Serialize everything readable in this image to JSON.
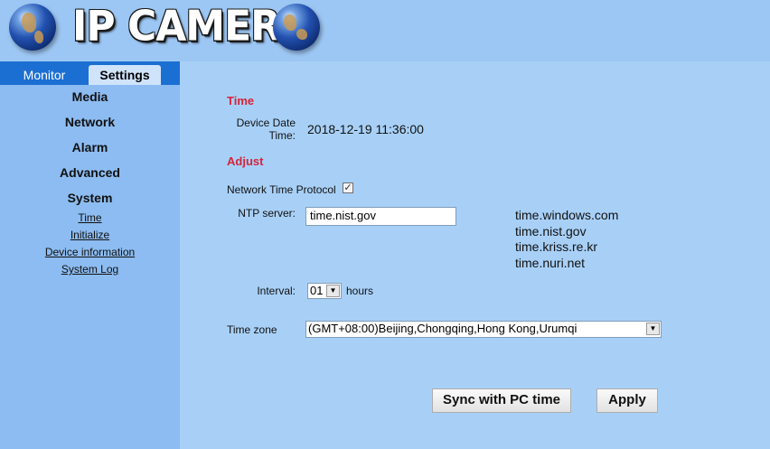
{
  "header": {
    "title": "IP CAMERA",
    "icons": [
      "globe-icon",
      "globe-icon"
    ]
  },
  "sidebar": {
    "tabs": [
      {
        "label": "Monitor",
        "active": false
      },
      {
        "label": "Settings",
        "active": true
      }
    ],
    "menu": [
      "Media",
      "Network",
      "Alarm",
      "Advanced",
      "System"
    ],
    "system_submenu": [
      "Time",
      "Initialize",
      "Device information",
      "System Log"
    ]
  },
  "time": {
    "section_title": "Time",
    "device_date_label_line1": "Device Date",
    "device_date_label_line2": "Time:",
    "device_date_value": "2018-12-19 11:36:00"
  },
  "adjust": {
    "section_title": "Adjust",
    "ntp_protocol_label": "Network Time Protocol",
    "ntp_protocol_checked": "✓",
    "ntp_server_label": "NTP server:",
    "ntp_server_value": "time.nist.gov",
    "ntp_server_list": [
      "time.windows.com",
      "time.nist.gov",
      "time.kriss.re.kr",
      "time.nuri.net"
    ],
    "interval_label": "Interval:",
    "interval_value": "01",
    "interval_unit": "hours",
    "timezone_label": "Time zone",
    "timezone_value": "(GMT+08:00)Beijing,Chongqing,Hong Kong,Urumqi"
  },
  "buttons": {
    "sync": "Sync with PC time",
    "apply": "Apply"
  },
  "colors": {
    "header_bg": "#9cc6f3",
    "sidebar_bg": "#8cbcf1",
    "tab_bar": "#1c6fd2",
    "main_bg": "#a8d0f7",
    "section_title": "#d5243a"
  }
}
